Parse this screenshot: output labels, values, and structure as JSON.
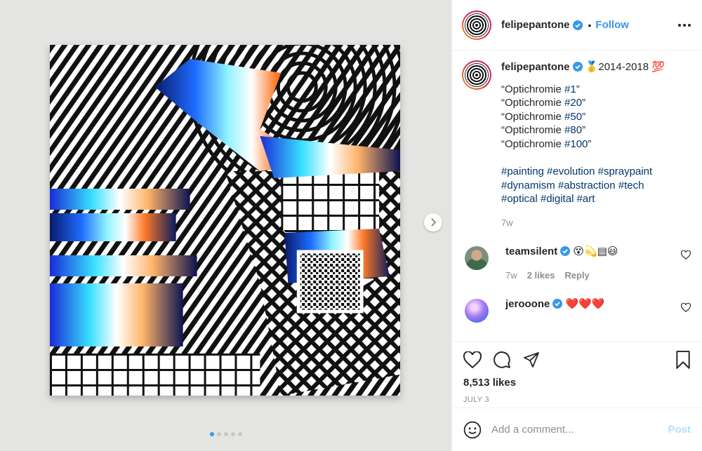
{
  "header": {
    "username": "felipepantone",
    "separator": "•",
    "follow_label": "Follow"
  },
  "caption": {
    "username": "felipepantone",
    "headline_text": "🥇2014-2018 💯",
    "lines": [
      {
        "prefix": "“Optichromie ",
        "tag": "#1",
        "suffix": "”"
      },
      {
        "prefix": "“Optichromie ",
        "tag": "#20",
        "suffix": "”"
      },
      {
        "prefix": "“Optichromie ",
        "tag": "#50",
        "suffix": "”"
      },
      {
        "prefix": "“Optichromie ",
        "tag": "#80",
        "suffix": "”"
      },
      {
        "prefix": "“Optichromie ",
        "tag": "#100",
        "suffix": "”"
      }
    ],
    "hashtags_line1": "#painting #evolution #spraypaint",
    "hashtags_line2": "#dynamism #abstraction #tech",
    "hashtags_line3": "#optical #digital #art",
    "time": "7w"
  },
  "comments": [
    {
      "username": "teamsilent",
      "text": "😵💫▤😃",
      "time": "7w",
      "likes": "2 likes",
      "reply": "Reply",
      "avatar": "person"
    },
    {
      "username": "jerooone",
      "text": "❤️❤️❤️",
      "avatar": "sphere"
    }
  ],
  "actions": {
    "likes": "8,513 likes",
    "date": "JULY 3",
    "icons": [
      "heart-icon",
      "comment-icon",
      "share-icon",
      "bookmark-icon"
    ]
  },
  "add_comment": {
    "placeholder": "Add a comment...",
    "post_label": "Post"
  },
  "carousel": {
    "slide_count": 5,
    "active_index": 0
  },
  "colors": {
    "accent": "#3897f0",
    "hashtag": "#00376b",
    "muted": "#8e8e8e",
    "post_disabled": "#b2dffc"
  }
}
